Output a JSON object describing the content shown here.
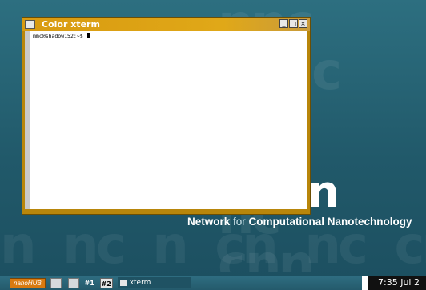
{
  "desktop": {
    "logo_letter": "n",
    "tagline_strong_1": "Network",
    "tagline_light": " for ",
    "tagline_strong_2": "Computational Nanotechnology"
  },
  "xterm": {
    "title": "Color xterm",
    "prompt": "mmc@shadow152:~$ ",
    "controls": [
      "minimize",
      "maximize",
      "close"
    ]
  },
  "taskbar": {
    "start_label": "nanoHUB",
    "workspaces": [
      {
        "label": "#1",
        "active": false
      },
      {
        "label": "#2",
        "active": true
      }
    ],
    "task_label": "xterm",
    "clock": "7:35 Jul 2"
  },
  "colors": {
    "desktop": "#2d6f80",
    "titlebar": "#d89a10",
    "start_button": "#d87a10"
  }
}
